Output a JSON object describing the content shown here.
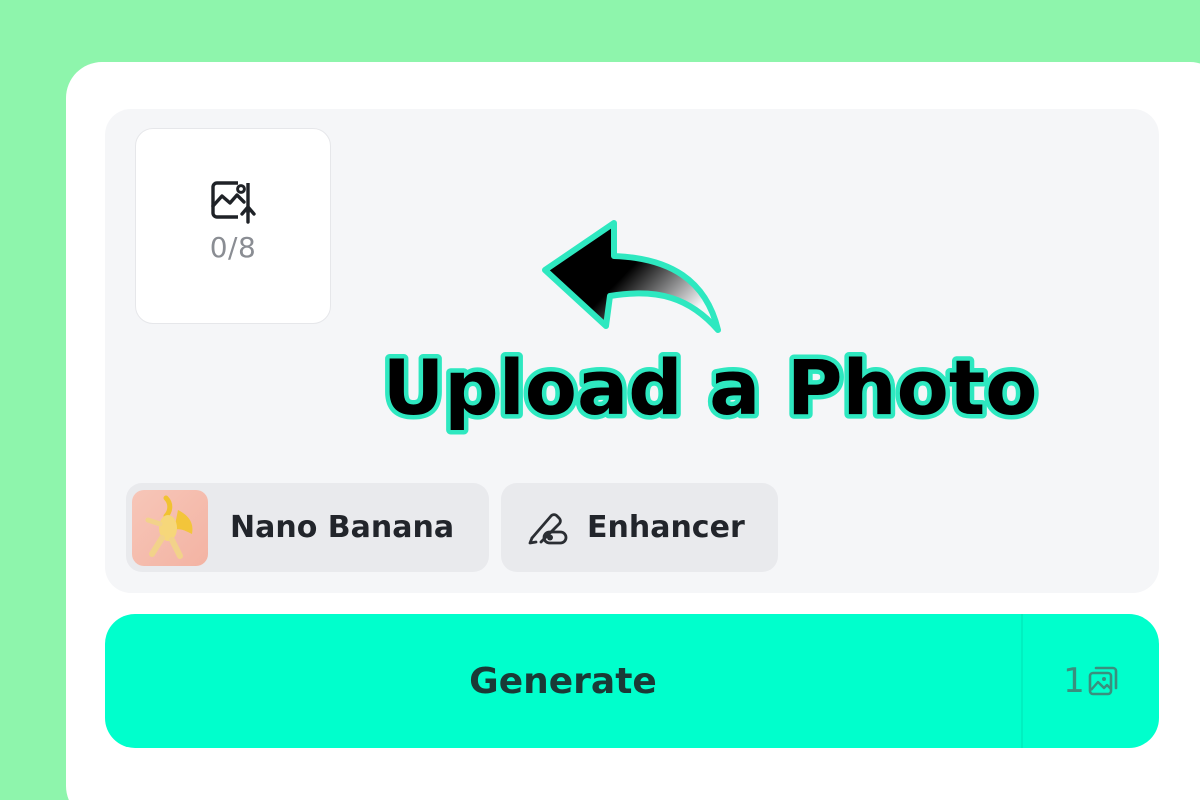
{
  "upload": {
    "count": "0/8",
    "icon": "image-upload-icon"
  },
  "overlay": {
    "instruction": "Upload a Photo",
    "arrow_icon": "curved-arrow-icon"
  },
  "options": {
    "model_label": "Nano Banana",
    "model_thumb": "nano-banana-thumbnail",
    "tool_label": "Enhancer",
    "tool_icon": "enhancer-icon"
  },
  "generate": {
    "label": "Generate",
    "count": "1",
    "count_icon": "images-icon"
  },
  "colors": {
    "background": "#8ef5ac",
    "accent": "#00ffcc",
    "overlay_stroke": "#2ee8c0",
    "text": "#22252b"
  }
}
